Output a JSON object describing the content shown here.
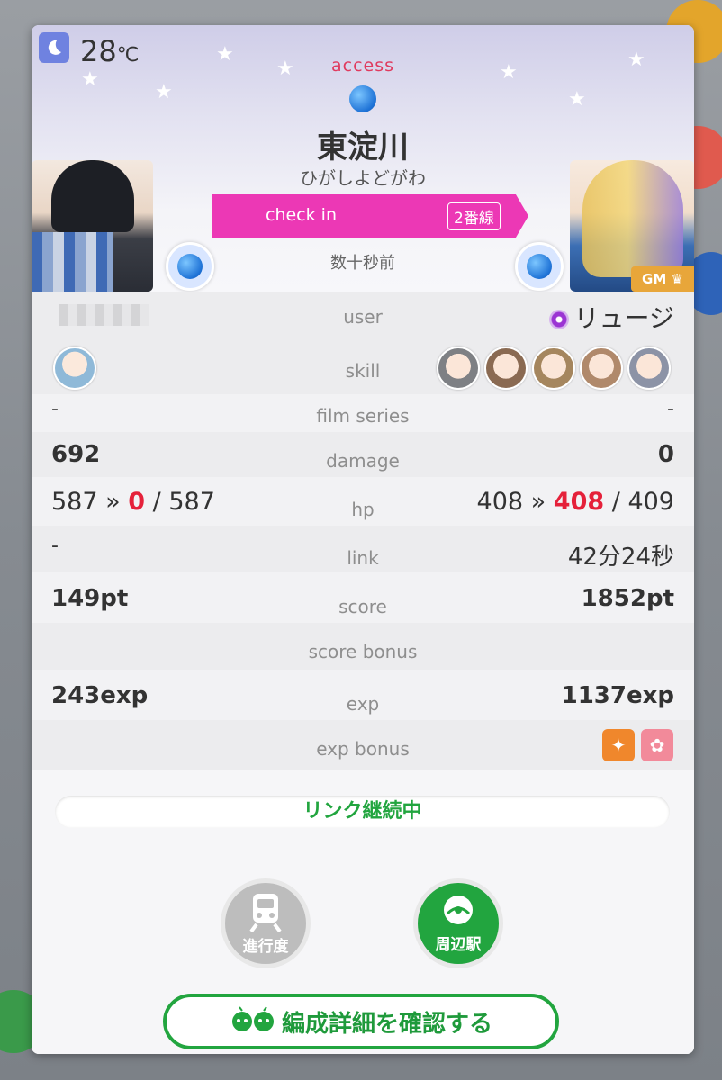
{
  "colors": {
    "accent_red": "#e5213a",
    "green": "#22a53f",
    "magenta": "#ec38b5",
    "gm_badge": "#e8a63a"
  },
  "header": {
    "weather_icon": "moon-icon",
    "temperature": "28",
    "temperature_unit": "℃",
    "access_label": "access",
    "station_name": "東淀川",
    "station_kana": "ひがしよどがわ",
    "checkin_label": "check in",
    "line_badge": "2番線",
    "time_ago": "数十秒前",
    "gm_badge": "GM"
  },
  "rows": {
    "user": {
      "label": "user",
      "right": "リュージ"
    },
    "skill": {
      "label": "skill"
    },
    "film_series": {
      "label": "film series",
      "left": "-",
      "right": "-"
    },
    "damage": {
      "label": "damage",
      "left": "692",
      "right": "0"
    },
    "hp": {
      "label": "hp",
      "left_current": "587",
      "left_after": "0",
      "left_max": "587",
      "right_current": "408",
      "right_after": "408",
      "right_max": "409",
      "arrow": "»",
      "slash": "/"
    },
    "link": {
      "label": "link",
      "left": "-",
      "right": "42分24秒"
    },
    "score": {
      "label": "score",
      "left": "149pt",
      "right": "1852pt"
    },
    "score_bonus": {
      "label": "score bonus"
    },
    "exp": {
      "label": "exp",
      "left": "243exp",
      "right": "1137exp"
    },
    "exp_bonus": {
      "label": "exp bonus"
    }
  },
  "bottom": {
    "link_status": "リンク継続中",
    "progress_button": "進行度",
    "nearby_button": "周辺駅",
    "confirm_button": "編成詳細を確認する"
  }
}
